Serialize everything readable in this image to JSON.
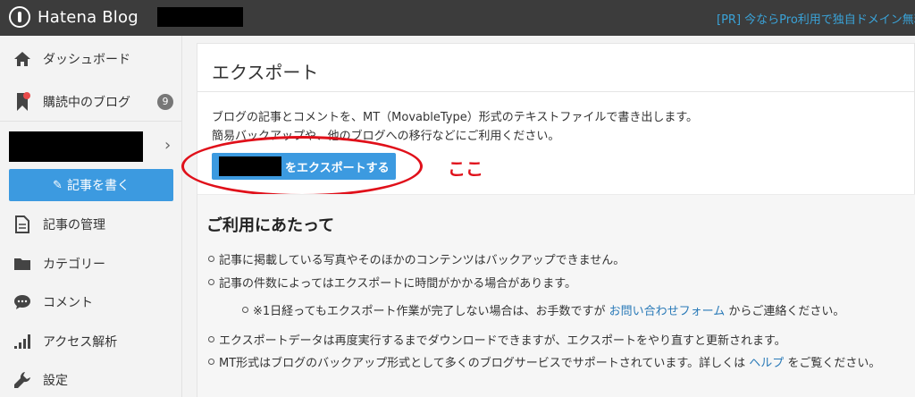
{
  "header": {
    "app_title": "Hatena Blog",
    "pr_text": "[PR] 今ならPro利用で独自ドメイン無料"
  },
  "sidebar": {
    "items": [
      {
        "label": "ダッシュボード",
        "icon": "home-icon"
      },
      {
        "label": "購読中のブログ",
        "icon": "bookmark-icon",
        "badge": "9"
      },
      {
        "label": "記事の管理",
        "icon": "document-icon"
      },
      {
        "label": "カテゴリー",
        "icon": "folder-icon"
      },
      {
        "label": "コメント",
        "icon": "comment-icon"
      },
      {
        "label": "アクセス解析",
        "icon": "bar-chart-icon"
      },
      {
        "label": "設定",
        "icon": "wrench-icon"
      }
    ],
    "write_button": "記事を書く"
  },
  "main": {
    "title": "エクスポート",
    "description_1": "ブログの記事とコメントを、MT（MovableType）形式のテキストファイルで書き出します。",
    "description_2": "簡易バックアップや、他のブログへの移行などにご利用ください。",
    "export_button": "をエクスポートする",
    "annotation": "ここ",
    "notes": {
      "title": "ご利用にあたって",
      "items": [
        "記事に掲載している写真やそのほかのコンテンツはバックアップできません。",
        "記事の件数によってはエクスポートに時間がかかる場合があります。",
        "エクスポートデータは再度実行するまでダウンロードできますが、エクスポートをやり直すと更新されます。"
      ],
      "sub_item": {
        "before": "※1日経ってもエクスポート作業が完了しない場合は、お手数ですが ",
        "link": "お問い合わせフォーム",
        "after": " からご連絡ください。"
      },
      "mt_item": {
        "before": "MT形式はブログのバックアップ形式として多くのブログサービスでサポートされています。詳しくは ",
        "link": "ヘルプ",
        "after": " をご覧ください。"
      }
    }
  },
  "colors": {
    "topbar": "#3c3c3c",
    "accent_blue": "#3c9ae0",
    "annotation_red": "#e0101a",
    "link": "#2a7ab8"
  }
}
